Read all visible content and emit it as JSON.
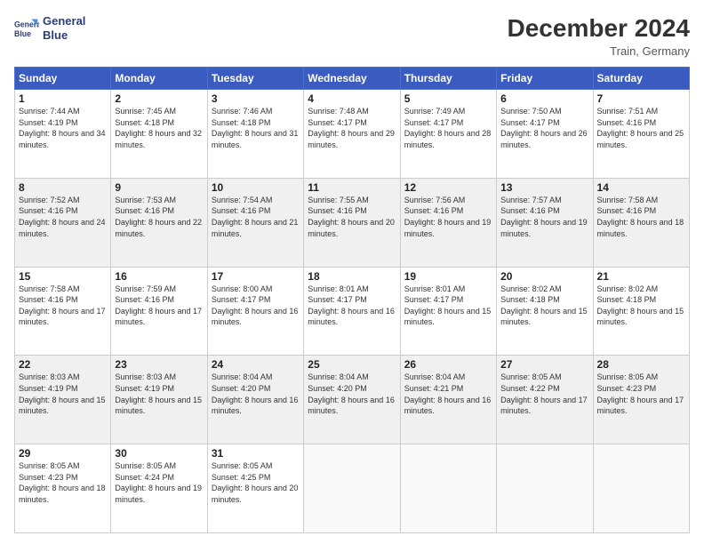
{
  "logo": {
    "line1": "General",
    "line2": "Blue"
  },
  "title": "December 2024",
  "location": "Train, Germany",
  "days_header": [
    "Sunday",
    "Monday",
    "Tuesday",
    "Wednesday",
    "Thursday",
    "Friday",
    "Saturday"
  ],
  "weeks": [
    [
      {
        "day": "1",
        "sunrise": "7:44 AM",
        "sunset": "4:19 PM",
        "daylight": "8 hours and 34 minutes."
      },
      {
        "day": "2",
        "sunrise": "7:45 AM",
        "sunset": "4:18 PM",
        "daylight": "8 hours and 32 minutes."
      },
      {
        "day": "3",
        "sunrise": "7:46 AM",
        "sunset": "4:18 PM",
        "daylight": "8 hours and 31 minutes."
      },
      {
        "day": "4",
        "sunrise": "7:48 AM",
        "sunset": "4:17 PM",
        "daylight": "8 hours and 29 minutes."
      },
      {
        "day": "5",
        "sunrise": "7:49 AM",
        "sunset": "4:17 PM",
        "daylight": "8 hours and 28 minutes."
      },
      {
        "day": "6",
        "sunrise": "7:50 AM",
        "sunset": "4:17 PM",
        "daylight": "8 hours and 26 minutes."
      },
      {
        "day": "7",
        "sunrise": "7:51 AM",
        "sunset": "4:16 PM",
        "daylight": "8 hours and 25 minutes."
      }
    ],
    [
      {
        "day": "8",
        "sunrise": "7:52 AM",
        "sunset": "4:16 PM",
        "daylight": "8 hours and 24 minutes."
      },
      {
        "day": "9",
        "sunrise": "7:53 AM",
        "sunset": "4:16 PM",
        "daylight": "8 hours and 22 minutes."
      },
      {
        "day": "10",
        "sunrise": "7:54 AM",
        "sunset": "4:16 PM",
        "daylight": "8 hours and 21 minutes."
      },
      {
        "day": "11",
        "sunrise": "7:55 AM",
        "sunset": "4:16 PM",
        "daylight": "8 hours and 20 minutes."
      },
      {
        "day": "12",
        "sunrise": "7:56 AM",
        "sunset": "4:16 PM",
        "daylight": "8 hours and 19 minutes."
      },
      {
        "day": "13",
        "sunrise": "7:57 AM",
        "sunset": "4:16 PM",
        "daylight": "8 hours and 19 minutes."
      },
      {
        "day": "14",
        "sunrise": "7:58 AM",
        "sunset": "4:16 PM",
        "daylight": "8 hours and 18 minutes."
      }
    ],
    [
      {
        "day": "15",
        "sunrise": "7:58 AM",
        "sunset": "4:16 PM",
        "daylight": "8 hours and 17 minutes."
      },
      {
        "day": "16",
        "sunrise": "7:59 AM",
        "sunset": "4:16 PM",
        "daylight": "8 hours and 17 minutes."
      },
      {
        "day": "17",
        "sunrise": "8:00 AM",
        "sunset": "4:17 PM",
        "daylight": "8 hours and 16 minutes."
      },
      {
        "day": "18",
        "sunrise": "8:01 AM",
        "sunset": "4:17 PM",
        "daylight": "8 hours and 16 minutes."
      },
      {
        "day": "19",
        "sunrise": "8:01 AM",
        "sunset": "4:17 PM",
        "daylight": "8 hours and 15 minutes."
      },
      {
        "day": "20",
        "sunrise": "8:02 AM",
        "sunset": "4:18 PM",
        "daylight": "8 hours and 15 minutes."
      },
      {
        "day": "21",
        "sunrise": "8:02 AM",
        "sunset": "4:18 PM",
        "daylight": "8 hours and 15 minutes."
      }
    ],
    [
      {
        "day": "22",
        "sunrise": "8:03 AM",
        "sunset": "4:19 PM",
        "daylight": "8 hours and 15 minutes."
      },
      {
        "day": "23",
        "sunrise": "8:03 AM",
        "sunset": "4:19 PM",
        "daylight": "8 hours and 15 minutes."
      },
      {
        "day": "24",
        "sunrise": "8:04 AM",
        "sunset": "4:20 PM",
        "daylight": "8 hours and 16 minutes."
      },
      {
        "day": "25",
        "sunrise": "8:04 AM",
        "sunset": "4:20 PM",
        "daylight": "8 hours and 16 minutes."
      },
      {
        "day": "26",
        "sunrise": "8:04 AM",
        "sunset": "4:21 PM",
        "daylight": "8 hours and 16 minutes."
      },
      {
        "day": "27",
        "sunrise": "8:05 AM",
        "sunset": "4:22 PM",
        "daylight": "8 hours and 17 minutes."
      },
      {
        "day": "28",
        "sunrise": "8:05 AM",
        "sunset": "4:23 PM",
        "daylight": "8 hours and 17 minutes."
      }
    ],
    [
      {
        "day": "29",
        "sunrise": "8:05 AM",
        "sunset": "4:23 PM",
        "daylight": "8 hours and 18 minutes."
      },
      {
        "day": "30",
        "sunrise": "8:05 AM",
        "sunset": "4:24 PM",
        "daylight": "8 hours and 19 minutes."
      },
      {
        "day": "31",
        "sunrise": "8:05 AM",
        "sunset": "4:25 PM",
        "daylight": "8 hours and 20 minutes."
      },
      null,
      null,
      null,
      null
    ]
  ]
}
